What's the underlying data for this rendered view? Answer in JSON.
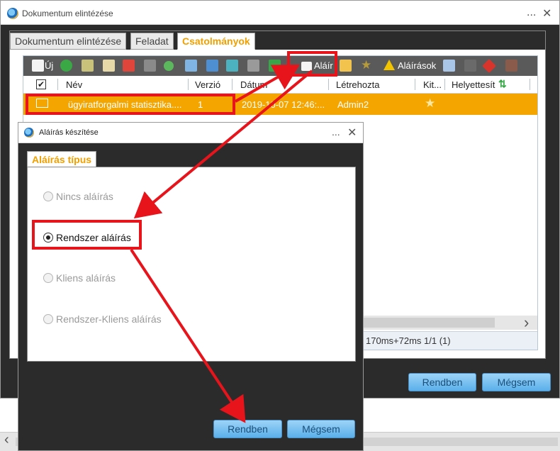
{
  "outer_window": {
    "title": "Dokumentum elintézése",
    "minimize_label": "...",
    "close_label": "✕",
    "tabs": [
      {
        "label": "Dokumentum elintézése"
      },
      {
        "label": "Feladat"
      },
      {
        "label": "Csatolmányok"
      }
    ],
    "toolbar": {
      "new_label": "Új",
      "sign_label": "Aláír",
      "signatures_label": "Aláírások"
    },
    "grid": {
      "columns": [
        "Név",
        "Verzió",
        "Dátum",
        "Létrehozta",
        "Kit...",
        "Helyettesít"
      ],
      "row": {
        "name": "ügyiratforgalmi statisztika....",
        "version": "1",
        "date": "2019-10-07 12:46:...",
        "created_by": "Admin2"
      },
      "status": "170ms+72ms 1/1 (1)",
      "scroll_right": "›"
    },
    "ok_label": "Rendben",
    "cancel_label": "Mégsem"
  },
  "dialog": {
    "title": "Aláírás készítése",
    "minimize_label": "...",
    "close_label": "✕",
    "tab_label": "Aláírás típus",
    "options": [
      {
        "label": "Nincs aláírás",
        "selected": false
      },
      {
        "label": "Rendszer aláírás",
        "selected": true
      },
      {
        "label": "Kliens aláírás",
        "selected": false
      },
      {
        "label": "Rendszer-Kliens aláírás",
        "selected": false
      }
    ],
    "ok_label": "Rendben",
    "cancel_label": "Mégsem"
  },
  "bottom_bar": {
    "scroll_left": "‹"
  },
  "colors": {
    "accent": "#f5a500",
    "annotation": "#e8141b",
    "button": "#5ab0ea",
    "dark_bg": "#2b2b2b"
  }
}
